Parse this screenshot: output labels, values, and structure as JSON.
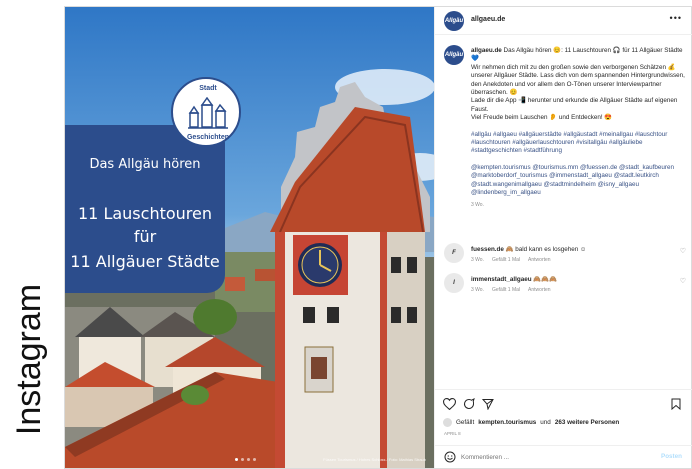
{
  "side_label": "Instagram",
  "post": {
    "image": {
      "badge_top": "Stadt",
      "badge_bottom": "Geschichten",
      "card_subtitle": "Das Allgäu hören",
      "card_line1": "11 Lauschtouren",
      "card_line2": "für",
      "card_line3": "11 Allgäuer Städte",
      "credit": "Füssen Tourismus / Hohes Schloss / Foto: Mathias Straub",
      "dots": [
        true,
        false,
        false,
        false
      ]
    },
    "header": {
      "avatar_text": "Allgäu",
      "username": "allgaeu.de",
      "more_icon": "more-icon"
    },
    "caption": {
      "username": "allgaeu.de",
      "lines": [
        "Das Allgäu hören 😊: 11 Lauschtouren 🎧 für 11 Allgäuer Städte 💙",
        "Wir nehmen dich mit zu den großen sowie den verborgenen Schätzen 💰 unserer Allgäuer Städte. Lass dich von dem spannenden Hintergrundwissen, den Anekdoten und vor allem den O-Tönen unserer Interviewpartner überraschen. 😊",
        "Lade dir die App 📲 herunter und erkunde die Allgäuer Städte auf eigenen Faust.",
        "Viel Freude beim Lauschen 👂 und Entdecken! 😍"
      ],
      "hashtags": "#allgäu #allgaeu #allgäuerstädte #allgäustadt #meinallgau #lauschtour #lauschtouren #allgäuerlauschtouren #visitallgäu #allgäuliebe #stadtgeschichten #stadtführung",
      "mentions": "@kempten.tourismus @tourismus.mm @fuessen.de @stadt_kaufbeuren @marktoberdorf_tourismus @immenstadt_allgaeu @stadt.leutkirch @stadt.wangenimallgaeu @stadtmindelheim @isny_allgaeu @lindenberg_im_allgaeu",
      "time": "3 Wo."
    },
    "comments": [
      {
        "username": "fuessen.de",
        "text": "🙈 bald kann es losgehen ☺",
        "time": "3 Wo.",
        "likes": "Gefällt 1 Mal",
        "reply": "Antworten"
      },
      {
        "username": "immenstadt_allgaeu",
        "text": "🙈🙈🙈",
        "time": "3 Wo.",
        "likes": "Gefällt 1 Mal",
        "reply": "Antworten"
      }
    ],
    "likes": {
      "prefix": "Gefällt",
      "user": "kempten.tourismus",
      "middle": "und",
      "others": "263 weitere Personen"
    },
    "date": "APRIL 8",
    "comment_box": {
      "placeholder": "Kommentieren ...",
      "post_label": "Posten"
    }
  }
}
